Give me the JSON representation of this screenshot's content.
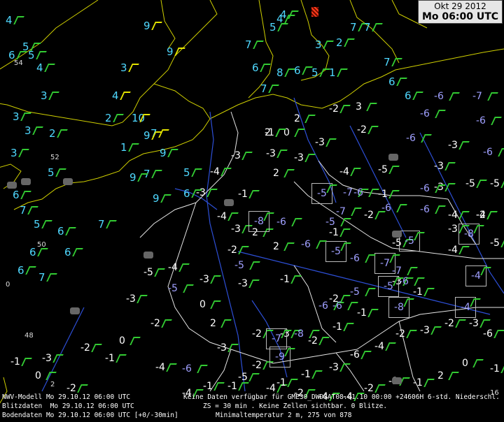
{
  "header": {
    "date": "Okt 29 2012",
    "time": "Mo 06:00 UTC"
  },
  "footer": {
    "rows": [
      {
        "label": "NWV-Modell",
        "date": "Mo 29.10.12 06:00 UTC",
        "info": "Keine Daten verfügbar für GME30_DWDSAT08.01.10 00:00 +24606H 6-std. Niederschl."
      },
      {
        "label": "Blitzdaten",
        "date": "Mo 29.10.12 06:00 UTC",
        "info": "ZS = 30 min . Keine Zellen sichtbar. 0 Blitze."
      },
      {
        "label": "Bodendaten",
        "date": "Mo 29.10.12 06:00 UTC [+0/-30min]",
        "info": "Minimaltemperatur 2 m, 275 von 878"
      }
    ]
  },
  "colors": {
    "background": "#000000",
    "coast": "#d8d800",
    "border": "#ffffff",
    "river": "#2d4fd6",
    "sea_temp": "#4fd8ff",
    "land_temp": "#ffffff",
    "cold_temp": "#a0a0ff",
    "wind": "#33cc33",
    "coast_wind": "#e6e600"
  },
  "map_labels": [
    "54",
    "52",
    "50",
    "48",
    "0",
    "2",
    "16"
  ],
  "sea_temps": [
    "4",
    "5",
    "9",
    "9",
    "3",
    "4",
    "2",
    "1",
    "7",
    "7",
    "9",
    "10",
    "9",
    "9",
    "9",
    "6",
    "5",
    "4",
    "3",
    "3",
    "3",
    "2",
    "3",
    "5",
    "6",
    "7",
    "5",
    "6",
    "6",
    "6",
    "7",
    "6",
    "7",
    "5",
    "6",
    "7",
    "6",
    "7",
    "8",
    "6",
    "5",
    "5",
    "4",
    "3",
    "4",
    "2",
    "1",
    "7",
    "7",
    "7",
    "6",
    "6"
  ],
  "land_temps": [
    "2",
    "0",
    "-3",
    "-2",
    "2",
    "3",
    "-2",
    "-4",
    "-5",
    "-5",
    "-3",
    "-3",
    "-4",
    "-1",
    "2",
    "-3",
    "-3",
    "-4",
    "-3",
    "-2",
    "2",
    "2",
    "-1",
    "-3",
    "-3",
    "-4",
    "-5",
    "-3",
    "-2",
    "-1",
    "-4",
    "0",
    "2",
    "-3",
    "-5",
    "-4",
    "-1",
    "-3",
    "-6",
    "-4",
    "-2",
    "-3",
    "-2",
    "-3",
    "-6",
    "-1",
    "0",
    "2",
    "-1",
    "-1",
    "-2",
    "-4",
    "-4",
    "-2",
    "-1",
    "-2",
    "-1",
    "-1",
    "-4",
    "-2",
    "0",
    "-1",
    "-3",
    "-2",
    "0",
    "-4",
    "-5",
    "-2",
    "-3",
    "-3",
    "-4",
    "-5",
    "-5",
    "-4",
    "-3",
    "-3",
    "-3",
    "-1",
    "-2",
    "-1",
    "-1",
    "-2",
    "-3",
    "-2",
    "-1",
    "-2",
    "-1",
    "-1"
  ],
  "cold_temps": [
    "-6",
    "-7",
    "-6",
    "-6",
    "-6",
    "-6",
    "-5",
    "-7",
    "-6",
    "-5",
    "-8",
    "-6",
    "-6",
    "-5",
    "-6",
    "-7",
    "-6",
    "-5",
    "-6",
    "-8",
    "-7",
    "-9",
    "-8",
    "-6",
    "-6",
    "-5",
    "-8",
    "-7",
    "-6",
    "-7",
    "-6",
    "-4",
    "-5",
    "-5",
    "-4",
    "-5",
    "-6"
  ]
}
